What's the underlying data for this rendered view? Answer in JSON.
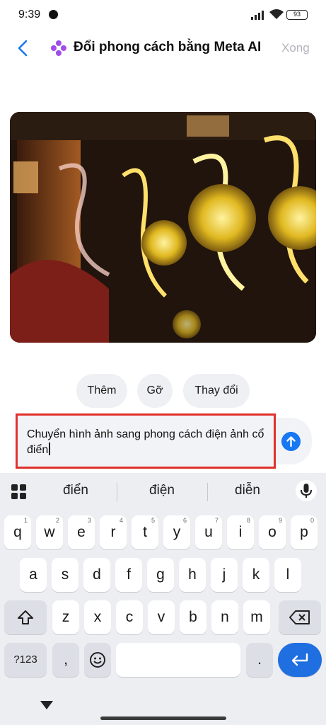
{
  "status_bar": {
    "time": "9:39",
    "battery": "93"
  },
  "header": {
    "title": "Đổi phong cách bằng Meta AI",
    "done_label": "Xong"
  },
  "chips": [
    {
      "label": "Thêm"
    },
    {
      "label": "Gỡ"
    },
    {
      "label": "Thay đổi"
    }
  ],
  "composer": {
    "text": "Chuyển hình ảnh sang phong cách điện ảnh cổ điển"
  },
  "keyboard": {
    "suggestions": [
      "điển",
      "điện",
      "diễn"
    ],
    "row1": [
      {
        "k": "q",
        "h": "1"
      },
      {
        "k": "w",
        "h": "2"
      },
      {
        "k": "e",
        "h": "3"
      },
      {
        "k": "r",
        "h": "4"
      },
      {
        "k": "t",
        "h": "5"
      },
      {
        "k": "y",
        "h": "6"
      },
      {
        "k": "u",
        "h": "7"
      },
      {
        "k": "i",
        "h": "8"
      },
      {
        "k": "o",
        "h": "9"
      },
      {
        "k": "p",
        "h": "0"
      }
    ],
    "row2": [
      "a",
      "s",
      "d",
      "f",
      "g",
      "h",
      "j",
      "k",
      "l"
    ],
    "row3": [
      "z",
      "x",
      "c",
      "v",
      "b",
      "n",
      "m"
    ],
    "symbols_label": "?123",
    "comma": ",",
    "period": "."
  },
  "colors": {
    "accent": "#1877f2",
    "highlight_border": "#e0302b",
    "enter_key": "#1f6fe0"
  },
  "icons": [
    "message-icon",
    "signal-icon",
    "wifi-icon",
    "battery-icon",
    "back-chevron-icon",
    "meta-ai-sparkle-icon",
    "send-arrow-icon",
    "apps-grid-icon",
    "microphone-icon",
    "shift-icon",
    "backspace-icon",
    "emoji-icon",
    "enter-icon",
    "nav-down-icon"
  ]
}
